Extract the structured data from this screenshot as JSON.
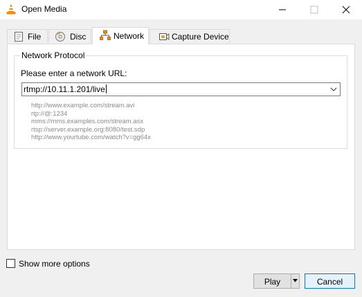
{
  "window": {
    "title": "Open Media",
    "icon": "vlc-cone-icon",
    "controls": [
      "minimize-icon",
      "maximize-icon",
      "close-icon"
    ]
  },
  "tabs": [
    {
      "label": "File",
      "icon": "file-icon",
      "active": false
    },
    {
      "label": "Disc",
      "icon": "disc-icon",
      "active": false
    },
    {
      "label": "Network",
      "icon": "network-icon",
      "active": true
    },
    {
      "label": "Capture Device",
      "icon": "capture-device-icon",
      "active": false
    }
  ],
  "network": {
    "group_title": "Network Protocol",
    "url_label": "Please enter a network URL:",
    "url_value": "rtmp://10.11.1.201/live",
    "examples": [
      "http://www.example.com/stream.avi",
      "rtp://@:1234",
      "mms://mms.examples.com/stream.asx",
      "rtsp://server.example.org:8080/test.sdp",
      "http://www.yourtube.com/watch?v=gg64x"
    ]
  },
  "options": {
    "show_more_label": "Show more options",
    "show_more_checked": false
  },
  "buttons": {
    "play": "Play",
    "cancel": "Cancel"
  },
  "colors": {
    "accent": "#0078d7",
    "vlc_orange": "#f28c00",
    "hint_text": "#8a8a8a"
  }
}
